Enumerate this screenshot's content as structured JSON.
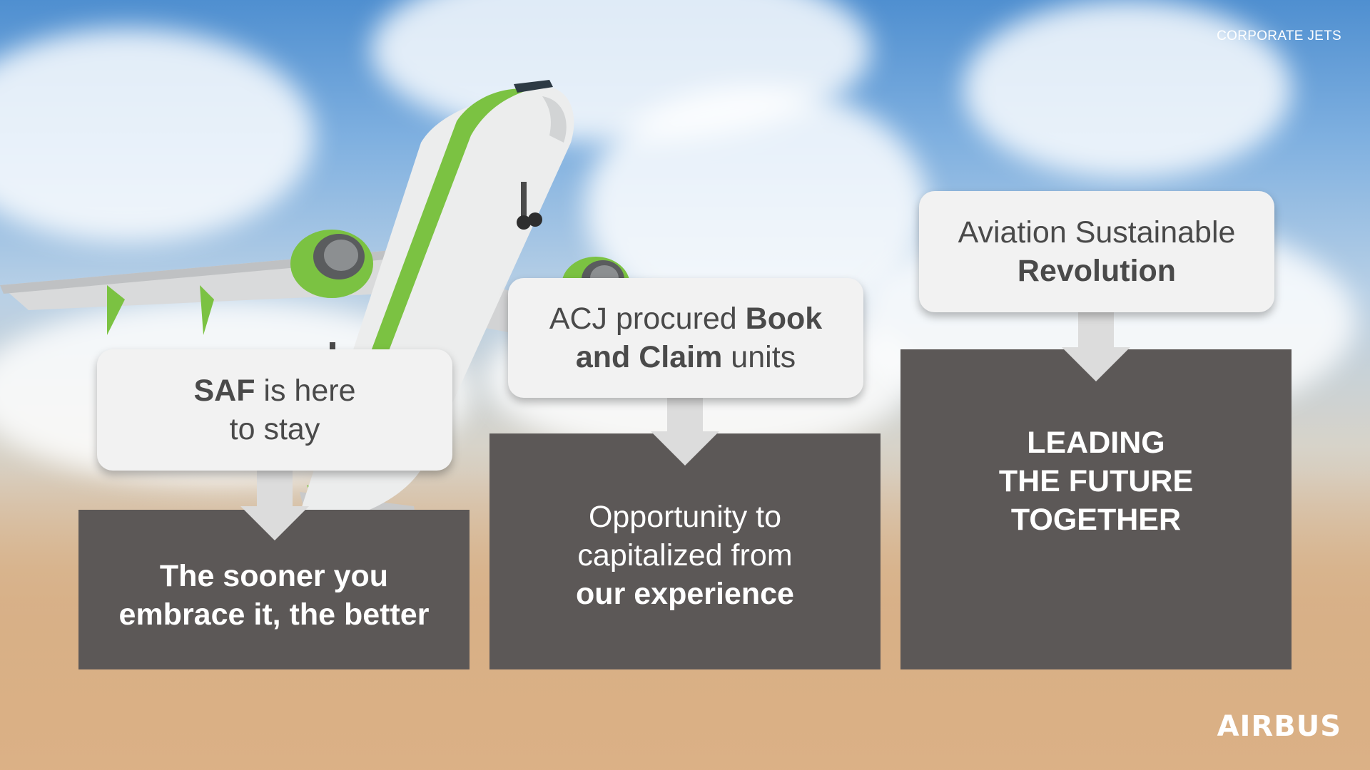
{
  "header": {
    "label": "CORPORATE JETS"
  },
  "brand": {
    "logo_text": "AIRBUS"
  },
  "colors": {
    "dark_box": "#5c5857",
    "light_box": "#f2f2f2",
    "arrow": "#dcdcdc",
    "plane_accent": "#7bc242"
  },
  "columns": [
    {
      "top": {
        "line1_bold": "SAF",
        "line1_rest": " is here",
        "line2": "to stay"
      },
      "bottom": {
        "line1": "The sooner you",
        "line2": "embrace it, the better"
      }
    },
    {
      "top": {
        "line1_pre": "ACJ procured ",
        "line1_bold": "Book",
        "line2_bold": "and Claim",
        "line2_rest": " units"
      },
      "bottom": {
        "line1": "Opportunity to",
        "line2": "capitalized from",
        "line3_bold": "our experience"
      }
    },
    {
      "top": {
        "line1": "Aviation Sustainable",
        "line2_bold": "Revolution"
      },
      "bottom": {
        "line1": "LEADING",
        "line2": "THE FUTURE",
        "line3": "TOGETHER"
      }
    }
  ]
}
